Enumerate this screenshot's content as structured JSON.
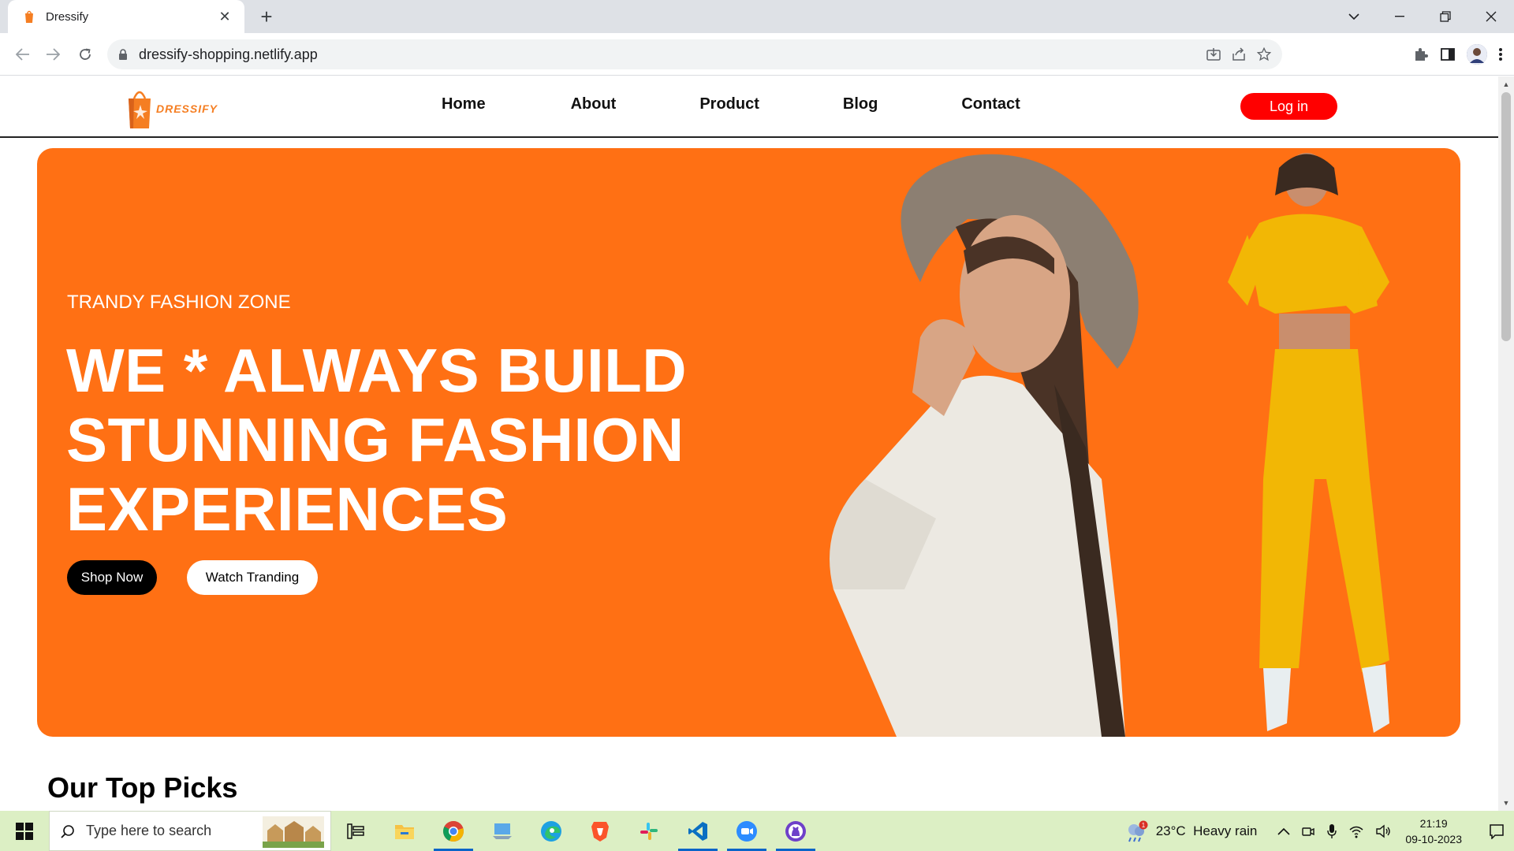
{
  "browser": {
    "tab_title": "Dressify",
    "url": "dressify-shopping.netlify.app"
  },
  "site": {
    "logo_name": "DRESSIFY",
    "nav": [
      "Home",
      "About",
      "Product",
      "Blog",
      "Contact"
    ],
    "login_label": "Log in"
  },
  "hero": {
    "subtitle": "TRANDY FASHION ZONE",
    "title_lines": [
      "WE * ALWAYS BUILD",
      "STUNNING FASHION",
      "EXPERIENCES"
    ],
    "shop_label": "Shop Now",
    "watch_label": "Watch Tranding",
    "bg_color": "#ff7014"
  },
  "sections": {
    "top_picks": "Our Top Picks"
  },
  "taskbar": {
    "search_placeholder": "Type here to search",
    "weather": "23°C  Heavy rain",
    "weather_badge": "1",
    "time": "21:19",
    "date": "09-10-2023"
  },
  "colors": {
    "accent": "#ff7014",
    "login": "#ff0000",
    "taskbar": "#dcefc4"
  }
}
